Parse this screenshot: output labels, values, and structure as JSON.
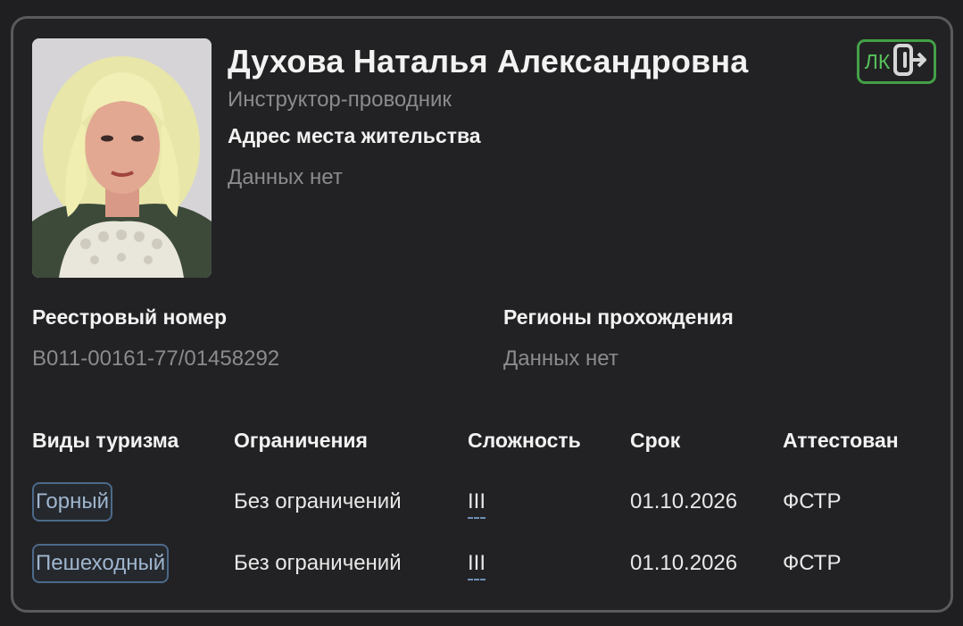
{
  "person": {
    "name": "Духова Наталья Александровна",
    "role": "Инструктор-проводник",
    "address_label": "Адрес места жительства",
    "address_value": "Данных нет"
  },
  "lk_button": {
    "label": "ЛК",
    "icon": "logout-icon",
    "accent": "#43a047"
  },
  "registry": {
    "label": "Реестровый номер",
    "value": "В011-00161-77/01458292"
  },
  "regions": {
    "label": "Регионы прохождения",
    "value": "Данных нет"
  },
  "table": {
    "headers": [
      "Виды туризма",
      "Ограничения",
      "Сложность",
      "Срок",
      "Аттестован"
    ],
    "rows": [
      {
        "type": "Горный",
        "limits": "Без ограничений",
        "difficulty": "III",
        "term": "01.10.2026",
        "certified": "ФСТР"
      },
      {
        "type": "Пешеходный",
        "limits": "Без ограничений",
        "difficulty": "III",
        "term": "01.10.2026",
        "certified": "ФСТР"
      }
    ]
  }
}
